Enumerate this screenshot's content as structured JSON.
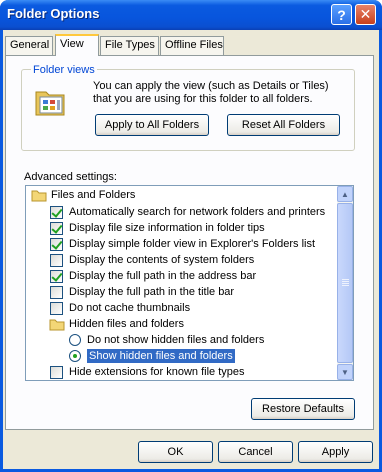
{
  "window": {
    "title": "Folder Options",
    "help_glyph": "?",
    "close_glyph": "✕"
  },
  "tabs": [
    {
      "label": "General"
    },
    {
      "label": "View"
    },
    {
      "label": "File Types"
    },
    {
      "label": "Offline Files"
    }
  ],
  "active_tab": "View",
  "folder_views": {
    "title": "Folder views",
    "description": "You can apply the view (such as Details or Tiles) that you are using for this folder to all folders.",
    "apply_label": "Apply to All Folders",
    "reset_label": "Reset All Folders"
  },
  "advanced": {
    "label": "Advanced settings:",
    "items": [
      {
        "type": "folder",
        "label": "Files and Folders",
        "checked": false
      },
      {
        "type": "checkbox",
        "label": "Automatically search for network folders and printers",
        "checked": true
      },
      {
        "type": "checkbox",
        "label": "Display file size information in folder tips",
        "checked": true
      },
      {
        "type": "checkbox",
        "label": "Display simple folder view in Explorer's Folders list",
        "checked": true
      },
      {
        "type": "checkbox",
        "label": "Display the contents of system folders",
        "checked": false
      },
      {
        "type": "checkbox",
        "label": "Display the full path in the address bar",
        "checked": true
      },
      {
        "type": "checkbox",
        "label": "Display the full path in the title bar",
        "checked": false
      },
      {
        "type": "checkbox",
        "label": "Do not cache thumbnails",
        "checked": false
      },
      {
        "type": "subfolder",
        "label": "Hidden files and folders",
        "checked": false
      },
      {
        "type": "radio",
        "label": "Do not show hidden files and folders",
        "checked": false
      },
      {
        "type": "radio",
        "label": "Show hidden files and folders",
        "checked": true,
        "selected": true
      },
      {
        "type": "checkbox",
        "label": "Hide extensions for known file types",
        "checked": false
      }
    ]
  },
  "restore_defaults_label": "Restore Defaults",
  "buttons": {
    "ok": "OK",
    "cancel": "Cancel",
    "apply": "Apply"
  },
  "colors": {
    "titlebar": "#0a5ae0",
    "selection": "#316ac5",
    "check_green": "#21a121",
    "group_title": "#0046d5"
  }
}
